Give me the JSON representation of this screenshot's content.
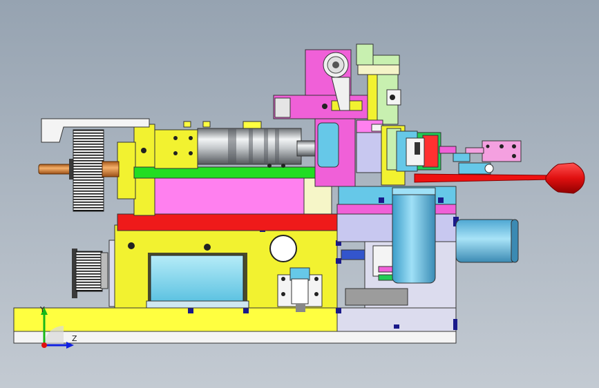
{
  "viewport": {
    "background_top": "#96a3b1",
    "background_bottom": "#c3cad2"
  },
  "triad": {
    "y_label": "Y",
    "z_label": "Z",
    "x_color": "#e01010",
    "y_color": "#18b818",
    "z_color": "#1020e0"
  },
  "colors": {
    "base_plate": "#ffff40",
    "base_bottom": "#f4f4f4",
    "frame": "#f2f230",
    "red_plate": "#ef1a1a",
    "magenta_body": "#ff80ef",
    "green_bar": "#22dd22",
    "cyan": "#66c8e8",
    "lavender": "#c8c8f0",
    "pink_plate": "#f060d8",
    "handle_red": "#ee1010"
  }
}
